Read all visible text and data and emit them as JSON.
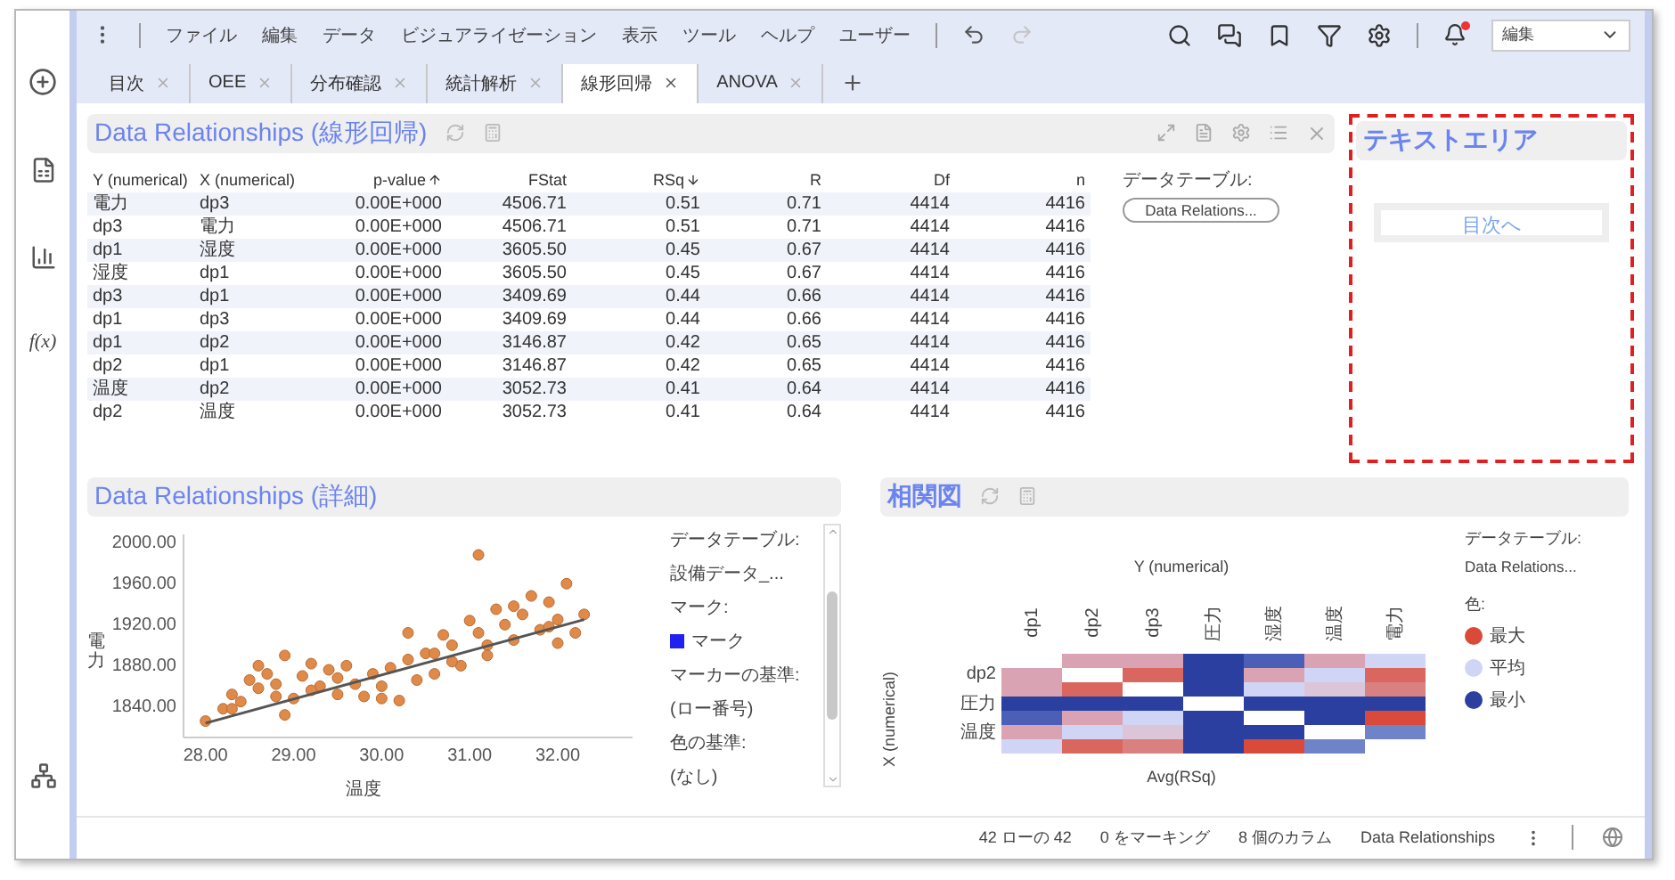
{
  "menu": {
    "items": [
      "ファイル",
      "編集",
      "データ",
      "ビジュアライゼーション",
      "表示",
      "ツール",
      "ヘルプ",
      "ユーザー"
    ],
    "redo_disabled": true,
    "notification": true,
    "mode": "編集"
  },
  "sidebar": {
    "formula": "f(x)"
  },
  "tabs": [
    {
      "label": "目次",
      "selected": false
    },
    {
      "label": "OEE",
      "selected": false
    },
    {
      "label": "分布確認",
      "selected": false
    },
    {
      "label": "統計解析",
      "selected": false
    },
    {
      "label": "線形回帰",
      "selected": true
    },
    {
      "label": "ANOVA",
      "selected": false
    }
  ],
  "table_panel": {
    "title": "Data Relationships (線形回帰)",
    "columns": [
      {
        "label": "Y (numerical)",
        "sorted": false
      },
      {
        "label": "X (numerical)",
        "sorted": false
      },
      {
        "label": "p-value",
        "sorted": true,
        "ascending": true
      },
      {
        "label": "FStat",
        "sorted": false
      },
      {
        "label": "RSq",
        "sorted": true,
        "ascending": false
      },
      {
        "label": "R",
        "sorted": false
      },
      {
        "label": "Df",
        "sorted": false
      },
      {
        "label": "n",
        "sorted": false
      }
    ],
    "rows": [
      [
        "電力",
        "dp3",
        "0.00E+000",
        "4506.71",
        "0.51",
        "0.71",
        "4414",
        "4416"
      ],
      [
        "dp3",
        "電力",
        "0.00E+000",
        "4506.71",
        "0.51",
        "0.71",
        "4414",
        "4416"
      ],
      [
        "dp1",
        "湿度",
        "0.00E+000",
        "3605.50",
        "0.45",
        "0.67",
        "4414",
        "4416"
      ],
      [
        "湿度",
        "dp1",
        "0.00E+000",
        "3605.50",
        "0.45",
        "0.67",
        "4414",
        "4416"
      ],
      [
        "dp3",
        "dp1",
        "0.00E+000",
        "3409.69",
        "0.44",
        "0.66",
        "4414",
        "4416"
      ],
      [
        "dp1",
        "dp3",
        "0.00E+000",
        "3409.69",
        "0.44",
        "0.66",
        "4414",
        "4416"
      ],
      [
        "dp1",
        "dp2",
        "0.00E+000",
        "3146.87",
        "0.42",
        "0.65",
        "4414",
        "4416"
      ],
      [
        "dp2",
        "dp1",
        "0.00E+000",
        "3146.87",
        "0.42",
        "0.65",
        "4414",
        "4416"
      ],
      [
        "温度",
        "dp2",
        "0.00E+000",
        "3052.73",
        "0.41",
        "0.64",
        "4414",
        "4416"
      ],
      [
        "dp2",
        "温度",
        "0.00E+000",
        "3052.73",
        "0.41",
        "0.64",
        "4414",
        "4416"
      ]
    ],
    "legend": {
      "label": "データテーブル:",
      "value": "Data Relations..."
    }
  },
  "text_area": {
    "title": "テキストエリア",
    "button": "目次へ"
  },
  "scatter_panel": {
    "title": "Data Relationships (詳細)",
    "chart_data": {
      "type": "scatter",
      "xlabel": "温度",
      "ylabel": "電力",
      "xlim": [
        27.75,
        32.85
      ],
      "ylim": [
        1810,
        2008
      ],
      "xticks": [
        {
          "value": 28,
          "label": "28.00"
        },
        {
          "value": 29,
          "label": "29.00"
        },
        {
          "value": 30,
          "label": "30.00"
        },
        {
          "value": 31,
          "label": "31.00"
        },
        {
          "value": 32,
          "label": "32.00"
        }
      ],
      "yticks": [
        {
          "value": 1840,
          "label": "1840.00"
        },
        {
          "value": 1880,
          "label": "1880.00"
        },
        {
          "value": 1920,
          "label": "1920.00"
        },
        {
          "value": 1960,
          "label": "1960.00"
        },
        {
          "value": 2000,
          "label": "2000.00"
        }
      ],
      "x": [
        28.0,
        28.2,
        28.3,
        28.4,
        28.5,
        28.6,
        28.6,
        28.7,
        28.8,
        28.9,
        29.0,
        29.1,
        29.2,
        29.3,
        29.4,
        29.5,
        29.6,
        29.7,
        29.8,
        29.9,
        30.0,
        30.1,
        30.2,
        30.3,
        30.4,
        30.5,
        30.6,
        30.7,
        30.8,
        30.9,
        31.0,
        31.1,
        31.1,
        31.2,
        31.3,
        31.4,
        31.5,
        31.6,
        31.7,
        31.8,
        31.9,
        32.0,
        32.1,
        32.2,
        32.3,
        28.9,
        30.3,
        31.2,
        28.3,
        28.8,
        29.5,
        30.0,
        30.8,
        31.5,
        32.0,
        29.2,
        30.6,
        31.9
      ],
      "series": [
        {
          "color": "#e08a4a",
          "values": [
            1826,
            1838,
            1852,
            1845,
            1866,
            1858,
            1880,
            1872,
            1862,
            1890,
            1848,
            1870,
            1882,
            1860,
            1876,
            1852,
            1880,
            1862,
            1850,
            1872,
            1860,
            1878,
            1846,
            1886,
            1866,
            1892,
            1872,
            1910,
            1900,
            1880,
            1924,
            1912,
            1988,
            1900,
            1935,
            1920,
            1905,
            1930,
            1948,
            1915,
            1942,
            1925,
            1960,
            1912,
            1930,
            1832,
            1912,
            1890,
            1838,
            1850,
            1868,
            1848,
            1884,
            1938,
            1902,
            1856,
            1892,
            1918
          ]
        },
        {
          "color": "#555555",
          "type": "line",
          "values": [
            1824,
            null,
            null,
            null,
            null,
            null,
            null,
            null,
            null,
            null,
            null,
            null,
            null,
            null,
            null,
            null,
            null,
            null,
            null,
            null,
            null,
            null,
            null,
            null,
            null,
            null,
            null,
            null,
            null,
            null,
            null,
            null,
            null,
            null,
            null,
            null,
            null,
            null,
            null,
            null,
            null,
            null,
            null,
            null,
            1925,
            null,
            null,
            null,
            null,
            null,
            null,
            null,
            null,
            null,
            null,
            null,
            null,
            null
          ]
        }
      ]
    },
    "legend": [
      {
        "kind": "label",
        "text": "データテーブル:"
      },
      {
        "kind": "value",
        "text": "設備データ_..."
      },
      {
        "kind": "label",
        "text": "マーク:"
      },
      {
        "kind": "swatch",
        "text": "マーク",
        "color": "#2020f0"
      },
      {
        "kind": "label",
        "text": "マーカーの基準:"
      },
      {
        "kind": "value",
        "text": "(ロー番号)"
      },
      {
        "kind": "label",
        "text": "色の基準:"
      },
      {
        "kind": "value",
        "text": "(なし)"
      }
    ]
  },
  "heatmap_panel": {
    "title": "相関図",
    "y_title": "Y (numerical)",
    "x_title": "X (numerical)",
    "caption": "Avg(RSq)",
    "columns": [
      "dp1",
      "dp2",
      "dp3",
      "圧力",
      "湿度",
      "温度",
      "電力"
    ],
    "rows": [
      {
        "cells": [
          null,
          {
            "color": "#d9a3b3"
          },
          {
            "color": "#d9a3b3"
          },
          {
            "color": "#2a3fa0"
          },
          {
            "color": "#4a5fb5"
          },
          {
            "color": "#d9a3b3"
          },
          {
            "color": "#d0d5f5"
          }
        ]
      },
      {
        "label": "dp2",
        "cells": [
          {
            "color": "#d9a3b3"
          },
          null,
          {
            "color": "#d9675f"
          },
          {
            "color": "#2a3fa0"
          },
          {
            "color": "#d9a3b3"
          },
          {
            "color": "#d0d5f5"
          },
          {
            "color": "#d9675f"
          }
        ]
      },
      {
        "cells": [
          {
            "color": "#d9a3b3"
          },
          {
            "color": "#d9675f"
          },
          null,
          {
            "color": "#2a3fa0"
          },
          {
            "color": "#d0d5f5"
          },
          {
            "color": "#dcc5d8"
          },
          {
            "color": "#d98080"
          }
        ]
      },
      {
        "label": "圧力",
        "cells": [
          {
            "color": "#2a3fa0"
          },
          {
            "color": "#2a3fa0"
          },
          {
            "color": "#2a3fa0"
          },
          null,
          {
            "color": "#2a3fa0"
          },
          {
            "color": "#2a3fa0"
          },
          {
            "color": "#2a3fa0"
          }
        ]
      },
      {
        "cells": [
          {
            "color": "#4a5fb5"
          },
          {
            "color": "#d9a3b3"
          },
          {
            "color": "#d0d5f5"
          },
          {
            "color": "#2a3fa0"
          },
          null,
          {
            "color": "#2a3fa0"
          },
          {
            "color": "#d94a3a"
          }
        ]
      },
      {
        "label": "温度",
        "cells": [
          {
            "color": "#d9a3b3"
          },
          {
            "color": "#d0d5f5"
          },
          {
            "color": "#dcc5d8"
          },
          {
            "color": "#2a3fa0"
          },
          {
            "color": "#2a3fa0"
          },
          null,
          {
            "color": "#6f84c8"
          }
        ]
      },
      {
        "cells": [
          {
            "color": "#d0d5f5"
          },
          {
            "color": "#d9675f"
          },
          {
            "color": "#d98080"
          },
          {
            "color": "#2a3fa0"
          },
          {
            "color": "#d94a3a"
          },
          {
            "color": "#6f84c8"
          },
          null
        ]
      }
    ],
    "legend": {
      "label": "データテーブル:",
      "value": "Data Relations...",
      "color_label": "色:",
      "items": [
        {
          "label": "最大",
          "color": "#d94a3a"
        },
        {
          "label": "平均",
          "color": "#d0d5f5"
        },
        {
          "label": "最小",
          "color": "#2a3fa0"
        }
      ]
    }
  },
  "status_bar": [
    "42 ローの 42",
    "0 をマーキング",
    "8 個のカラム",
    "Data Relationships"
  ]
}
